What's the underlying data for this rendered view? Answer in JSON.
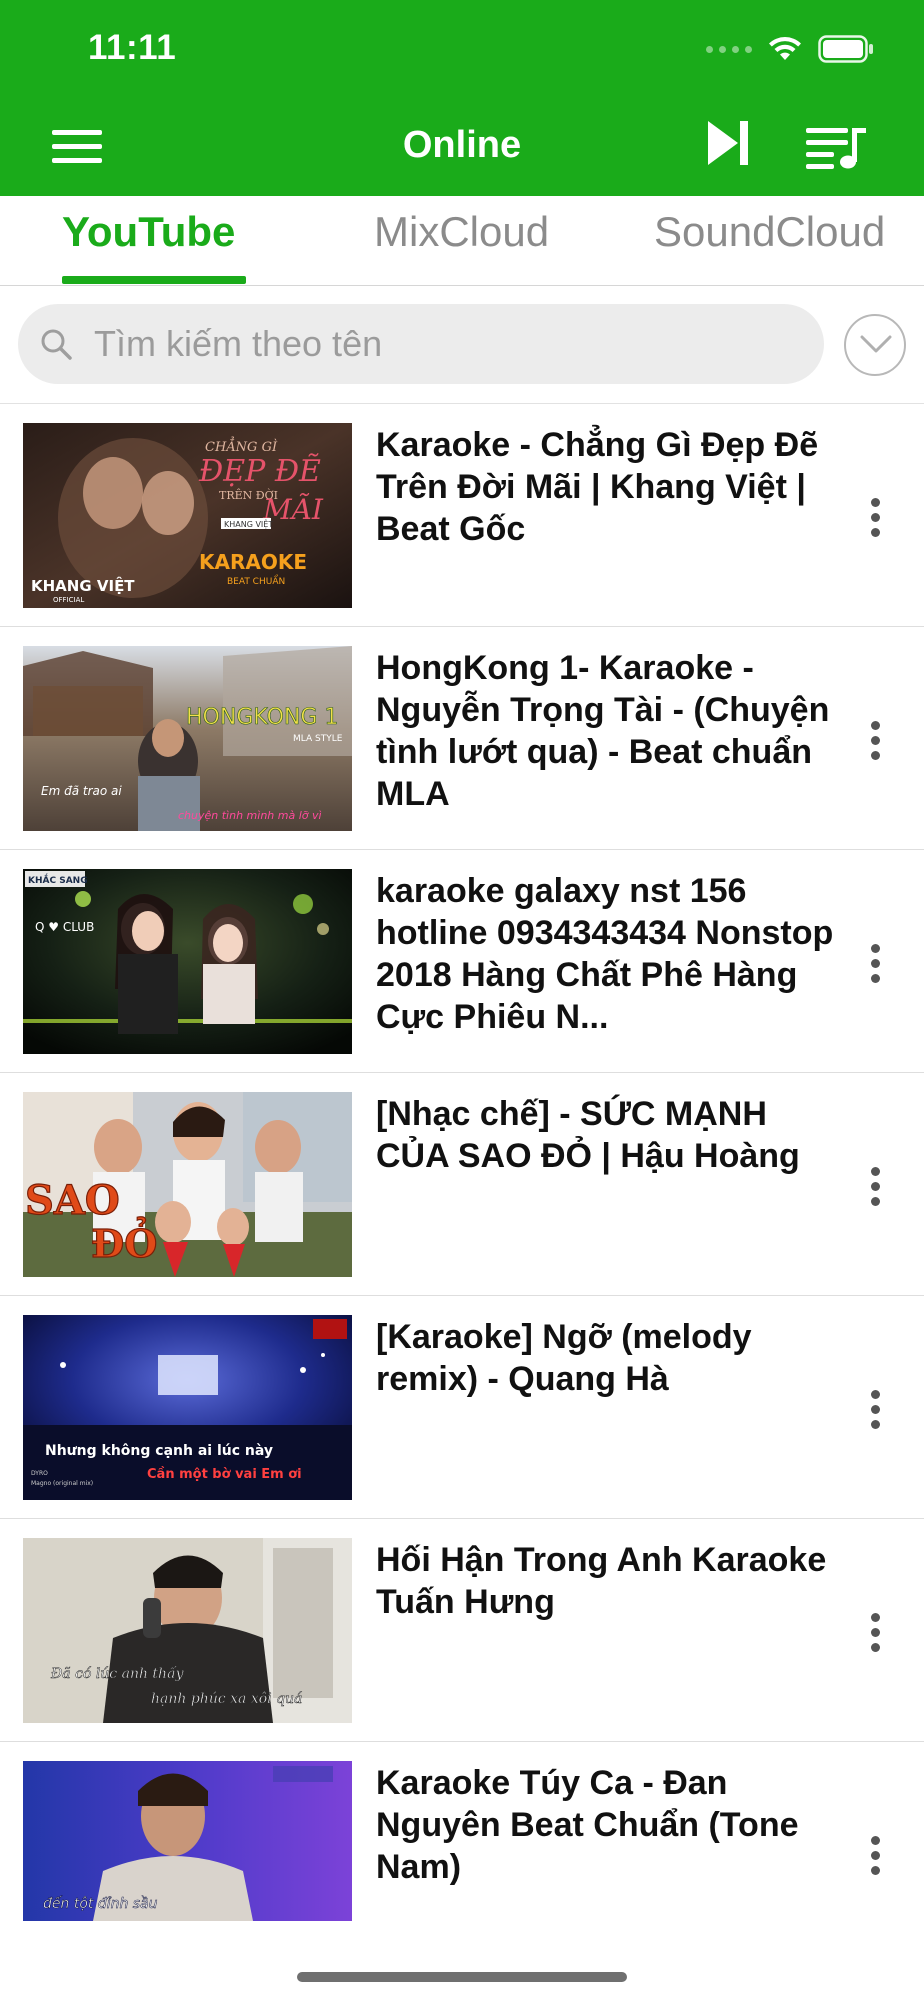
{
  "status_bar": {
    "time": "11:11"
  },
  "nav": {
    "title": "Online"
  },
  "tabs": [
    {
      "label": "YouTube",
      "active": true
    },
    {
      "label": "MixCloud",
      "active": false
    },
    {
      "label": "SoundCloud",
      "active": false
    }
  ],
  "search": {
    "placeholder": "Tìm kiếm theo tên",
    "value": ""
  },
  "colors": {
    "accent": "#1aab1a",
    "text": "#111111",
    "muted": "#8b8b8b"
  },
  "icons": {
    "menu": "hamburger-icon",
    "play_next": "skip-next-icon",
    "queue": "playlist-icon",
    "search": "search-icon",
    "filter": "chevron-down-circle-icon",
    "more": "more-vertical-icon"
  },
  "videos": [
    {
      "title": "Karaoke - Chẳng Gì Đẹp Đẽ Trên Đời Mãi | Khang Việt | Beat Gốc",
      "thumb_text": [
        "CHẲNG GÌ",
        "ĐẸP ĐẼ",
        "TRÊN ĐỜI",
        "MÃI",
        "KHANG VIỆT",
        "KARAOKE",
        "BEAT CHUẨN",
        "KHANG VIỆT",
        "OFFICIAL"
      ]
    },
    {
      "title": "HongKong 1- Karaoke - Nguyễn Trọng Tài - (Chuyện tình lướt qua) - Beat chuẩn MLA",
      "thumb_text": [
        "HONGKONG 1",
        "MLA STYLE",
        "Em đã trao ai",
        "chuyện tình mình mà lỡ vì"
      ]
    },
    {
      "title": "karaoke galaxy nst 156 hotline 0934343434 Nonstop 2018   Hàng Chất Phê Hàng Cực Phiêu   N...",
      "thumb_text": [
        "KHẮC SANG",
        "Q ♥ CLUB"
      ]
    },
    {
      "title": "[Nhạc chế] - SỨC MẠNH CỦA SAO ĐỎ | Hậu Hoàng",
      "thumb_text": [
        "SAO",
        "ĐỎ"
      ]
    },
    {
      "title": "[Karaoke] Ngỡ (melody remix) - Quang Hà",
      "thumb_text": [
        "Nhưng không cạnh ai lúc này",
        "Cần một bờ vai Em ơi",
        "DYRO",
        "Magno (original mix)"
      ]
    },
    {
      "title": "Hối Hận Trong Anh Karaoke  Tuấn Hưng",
      "thumb_text": [
        "Đã có lúc anh thấy",
        "hạnh phúc xa xôi quá"
      ]
    },
    {
      "title": "Karaoke Túy Ca - Đan Nguyên Beat Chuẩn (Tone Nam)",
      "thumb_text": [
        "đến tột đỉnh sầu"
      ]
    }
  ]
}
